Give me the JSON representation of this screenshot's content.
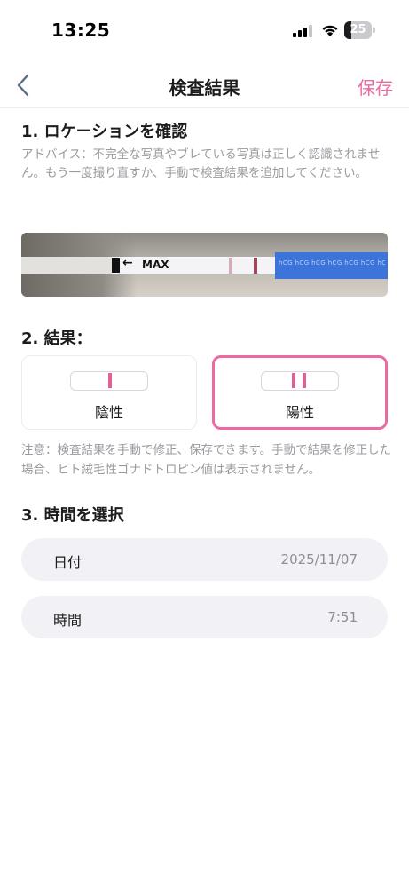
{
  "status_bar": {
    "time": "13:25",
    "battery_level": "25",
    "battery_fraction": 0.25,
    "icons": [
      "signal-icon",
      "wifi-icon",
      "battery-icon"
    ]
  },
  "nav": {
    "title": "検査結果",
    "save_label": "保存",
    "back_icon": "chevron-left-icon"
  },
  "colors": {
    "accent": "#ec6aa0",
    "text_primary": "#1c1c1e",
    "text_secondary": "#9a9aa0",
    "row_background": "#f2f2f6"
  },
  "location": {
    "heading": "1. ロケーションを確認",
    "advice": "アドバイス：不完全な写真やブレている写真は正しく認識されません。もう一度撮り直すか、手動で検査結果を追加してください。",
    "photo_marker": "MAX"
  },
  "result": {
    "heading": "2. 結果：",
    "options": [
      {
        "label": "陰性",
        "lines": 1,
        "selected": false
      },
      {
        "label": "陽性",
        "lines": 2,
        "selected": true
      }
    ],
    "note": "注意：検査結果を手動で修正、保存できます。手動で結果を修正した場合、ヒト絨毛性ゴナドトロピン値は表示されません。"
  },
  "time_select": {
    "heading": "3. 時間を選択",
    "date_label": "日付",
    "date_value": "2025/11/07",
    "time_label": "時間",
    "time_value": "7:51"
  }
}
